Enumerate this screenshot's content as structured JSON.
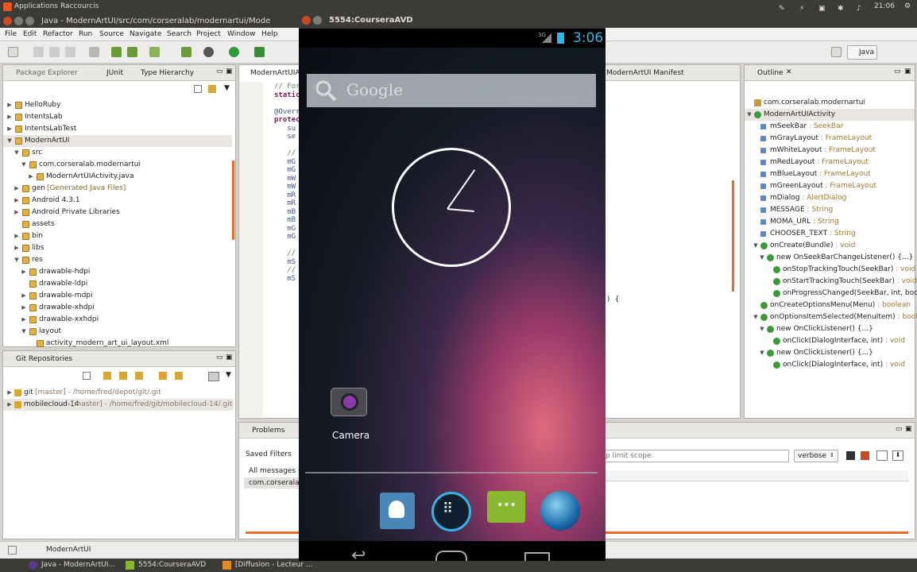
{
  "topbar": {
    "applications": "Applications",
    "raccourcis": "Raccourcis",
    "time": "21:06"
  },
  "window": {
    "title": "Java - ModernArtUI/src/com/corseralab/modernartui/Mode"
  },
  "menu": [
    "File",
    "Edit",
    "Refactor",
    "Run",
    "Source",
    "Navigate",
    "Search",
    "Project",
    "Window",
    "Help"
  ],
  "perspective": "Java",
  "package_explorer": {
    "tabs": [
      "Package Explorer",
      "JUnit",
      "Type Hierarchy"
    ],
    "tree": [
      {
        "label": "HelloRuby",
        "indent": 0,
        "tw": "▶"
      },
      {
        "label": "IntentsLab",
        "indent": 0,
        "tw": "▶"
      },
      {
        "label": "IntentsLabTest",
        "indent": 0,
        "tw": "▶"
      },
      {
        "label": "ModernArtUI",
        "indent": 0,
        "tw": "▼"
      },
      {
        "label": "src",
        "indent": 1,
        "tw": "▼"
      },
      {
        "label": "com.corseralab.modernartui",
        "indent": 2,
        "tw": "▼"
      },
      {
        "label": "ModernArtUIActivity.java",
        "indent": 3,
        "tw": "▶"
      },
      {
        "label": "gen",
        "extra": "[Generated Java Files]",
        "indent": 1,
        "tw": "▶"
      },
      {
        "label": "Android 4.3.1",
        "indent": 1,
        "tw": "▶"
      },
      {
        "label": "Android Private Libraries",
        "indent": 1,
        "tw": "▶"
      },
      {
        "label": "assets",
        "indent": 1,
        "tw": ""
      },
      {
        "label": "bin",
        "indent": 1,
        "tw": "▶"
      },
      {
        "label": "libs",
        "indent": 1,
        "tw": "▶"
      },
      {
        "label": "res",
        "indent": 1,
        "tw": "▼"
      },
      {
        "label": "drawable-hdpi",
        "indent": 2,
        "tw": "▶"
      },
      {
        "label": "drawable-ldpi",
        "indent": 2,
        "tw": ""
      },
      {
        "label": "drawable-mdpi",
        "indent": 2,
        "tw": "▶"
      },
      {
        "label": "drawable-xhdpi",
        "indent": 2,
        "tw": "▶"
      },
      {
        "label": "drawable-xxhdpi",
        "indent": 2,
        "tw": "▶"
      },
      {
        "label": "layout",
        "indent": 2,
        "tw": "▼"
      },
      {
        "label": "activity_modern_art_ui_layout.xml",
        "indent": 3,
        "tw": ""
      }
    ]
  },
  "git": {
    "tab": "Git Repositories",
    "repos": [
      {
        "name": "git",
        "extra": "[master] - /home/fred/depot/git/.git"
      },
      {
        "name": "mobilecloud-14",
        "extra": "[master] - /home/fred/git/mobilecloud-14/.git"
      }
    ]
  },
  "editor": {
    "tab": "ModernArtUIA",
    "tab2": "ModernArtUI Manifest",
    "code": [
      "// For",
      "static",
      "",
      "@Overr",
      "protec",
      "   su",
      "   se",
      "",
      "   //",
      "   mG",
      "   mG",
      "   mW",
      "   mW",
      "   mR",
      "   mR",
      "   mB",
      "   mB",
      "   mG",
      "   mG",
      "",
      "   //",
      "   mS",
      "   //",
      "   mS"
    ],
    "code_tail": ") {"
  },
  "outline": {
    "tab": "Outline",
    "items": [
      {
        "label": "com.corseralab.modernartui",
        "type": "",
        "indent": 0,
        "tw": "",
        "icon": "pkg"
      },
      {
        "label": "ModernArtUIActivity",
        "type": "",
        "indent": 0,
        "tw": "▼",
        "icon": "grn"
      },
      {
        "label": "mSeekBar",
        "type": "SeekBar",
        "indent": 1,
        "tw": "",
        "icon": "sq"
      },
      {
        "label": "mGrayLayout",
        "type": "FrameLayout",
        "indent": 1,
        "tw": "",
        "icon": "sq"
      },
      {
        "label": "mWhiteLayout",
        "type": "FrameLayout",
        "indent": 1,
        "tw": "",
        "icon": "sq"
      },
      {
        "label": "mRedLayout",
        "type": "FrameLayout",
        "indent": 1,
        "tw": "",
        "icon": "sq"
      },
      {
        "label": "mBlueLayout",
        "type": "FrameLayout",
        "indent": 1,
        "tw": "",
        "icon": "sq"
      },
      {
        "label": "mGreenLayout",
        "type": "FrameLayout",
        "indent": 1,
        "tw": "",
        "icon": "sq"
      },
      {
        "label": "mDialog",
        "type": "AlertDialog",
        "indent": 1,
        "tw": "",
        "icon": "sq"
      },
      {
        "label": "MESSAGE",
        "type": "String",
        "indent": 1,
        "tw": "",
        "icon": "sq"
      },
      {
        "label": "MOMA_URL",
        "type": "String",
        "indent": 1,
        "tw": "",
        "icon": "sq"
      },
      {
        "label": "CHOOSER_TEXT",
        "type": "String",
        "indent": 1,
        "tw": "",
        "icon": "sq"
      },
      {
        "label": "onCreate(Bundle)",
        "type": "void",
        "indent": 1,
        "tw": "▼",
        "icon": "grn"
      },
      {
        "label": "new OnSeekBarChangeListener() {...}",
        "type": "",
        "indent": 2,
        "tw": "▼",
        "icon": "grn"
      },
      {
        "label": "onStopTrackingTouch(SeekBar)",
        "type": "void",
        "indent": 3,
        "tw": "",
        "icon": "grn"
      },
      {
        "label": "onStartTrackingTouch(SeekBar)",
        "type": "void",
        "indent": 3,
        "tw": "",
        "icon": "grn"
      },
      {
        "label": "onProgressChanged(SeekBar, int, boole",
        "type": "",
        "indent": 3,
        "tw": "",
        "icon": "grn"
      },
      {
        "label": "onCreateOptionsMenu(Menu)",
        "type": "boolean",
        "indent": 1,
        "tw": "",
        "icon": "grn"
      },
      {
        "label": "onOptionsItemSelected(MenuItem)",
        "type": "boolea",
        "indent": 1,
        "tw": "▼",
        "icon": "grn"
      },
      {
        "label": "new OnClickListener() {...}",
        "type": "",
        "indent": 2,
        "tw": "▼",
        "icon": "grn"
      },
      {
        "label": "onClick(DialogInterface, int)",
        "type": "void",
        "indent": 3,
        "tw": "",
        "icon": "grn"
      },
      {
        "label": "new OnClickListener() {...}",
        "type": "",
        "indent": 2,
        "tw": "▼",
        "icon": "grn"
      },
      {
        "label": "onClick(DialogInterface, int)",
        "type": "void",
        "indent": 3,
        "tw": "",
        "icon": "grn"
      }
    ]
  },
  "console": {
    "tab": "Problems",
    "saved_filters": "Saved Filters",
    "all_messages": "All messages (n",
    "filter_item": "com.corseralab",
    "search_placeholder": "p limit scope.",
    "level": "verbose"
  },
  "emulator": {
    "title": "5554:CourseraAVD",
    "network": "3G",
    "time": "3:06",
    "search": "Google",
    "app_label": "Camera"
  },
  "statusline": {
    "project": "ModernArtUI"
  },
  "taskbar": {
    "items": [
      "Java - ModernArtUI...",
      "5554:CourseraAVD",
      "[Diffusion - Lecteur ..."
    ]
  },
  "colors": {
    "ubuntu_bar": "#3c3b37",
    "accent_orange": "#e96b2b",
    "android_blue": "#33b5e5"
  }
}
